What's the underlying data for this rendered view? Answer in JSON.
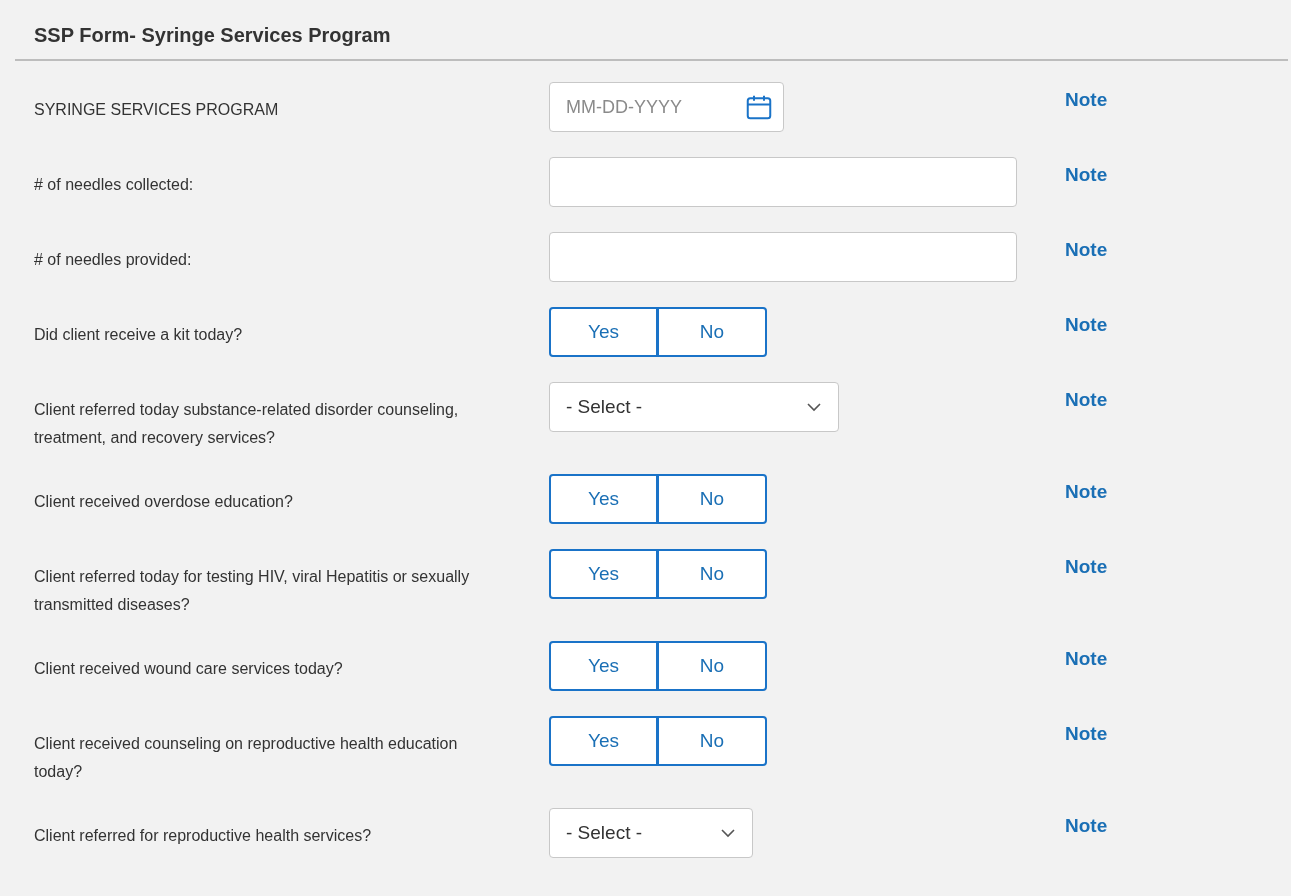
{
  "header": {
    "title": "SSP Form- Syringe Services Program"
  },
  "rows": [
    {
      "kind": "date",
      "label": "SYRINGE SERVICES PROGRAM",
      "placeholder": "MM-DD-YYYY",
      "note": "Note"
    },
    {
      "kind": "text",
      "label": "# of needles collected:",
      "note": "Note"
    },
    {
      "kind": "text",
      "label": "# of needles provided:",
      "note": "Note"
    },
    {
      "kind": "yesno",
      "label": "Did client receive a kit today?",
      "options": [
        {
          "label": "Yes",
          "selected": false
        },
        {
          "label": "No",
          "selected": false
        }
      ],
      "note": "Note"
    },
    {
      "kind": "select",
      "label": "Client referred today substance-related disorder counseling, treatment, and recovery services?",
      "value": "- Select -",
      "note": "Note"
    },
    {
      "kind": "yesno",
      "label": "Client received overdose education?",
      "options": [
        {
          "label": "Yes",
          "selected": false
        },
        {
          "label": "No",
          "selected": false
        }
      ],
      "note": "Note"
    },
    {
      "kind": "yesno",
      "label": "Client referred today for testing HIV, viral Hepatitis or sexually transmitted diseases?",
      "options": [
        {
          "label": "Yes",
          "selected": false
        },
        {
          "label": "No",
          "selected": false
        }
      ],
      "note": "Note"
    },
    {
      "kind": "yesno",
      "label": "Client received wound care services today?",
      "options": [
        {
          "label": "Yes",
          "selected": false
        },
        {
          "label": "No",
          "selected": false
        }
      ],
      "note": "Note"
    },
    {
      "kind": "yesno",
      "label": "Client received counseling on reproductive health education today?",
      "options": [
        {
          "label": "Yes",
          "selected": false
        },
        {
          "label": "No",
          "selected": false
        }
      ],
      "note": "Note"
    },
    {
      "kind": "select",
      "label": "Client referred for reproductive health services?",
      "value": "- Select -",
      "note": "Note"
    }
  ]
}
